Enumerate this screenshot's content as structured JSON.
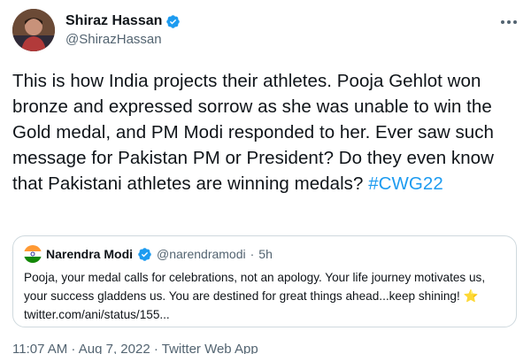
{
  "author": {
    "display_name": "Shiraz Hassan",
    "handle": "@ShirazHassan",
    "avatar_icon": "profile-photo",
    "verified": true
  },
  "tweet": {
    "text": "This is how India projects their athletes. Pooja Gehlot won bronze and expressed sorrow as she was unable to win the Gold medal, and PM Modi responded to her. Ever saw such message for Pakistan PM or President? Do they even know that Pakistani athletes are winning medals?",
    "hashtag": "#CWG22"
  },
  "quoted_tweet": {
    "display_name": "Narendra Modi",
    "handle": "@narendramodi",
    "separator": "·",
    "time": "5h",
    "text": "Pooja, your medal calls for celebrations, not an apology. Your life journey motivates us, your success gladdens us. You are destined for great things ahead...keep shining!",
    "emoji": "⭐",
    "link": "twitter.com/ani/status/155..."
  },
  "meta": {
    "footer": "11:07 AM · Aug 7, 2022 · Twitter Web App"
  },
  "colors": {
    "accent": "#1d9bf0",
    "text": "#0f1419",
    "secondary": "#536471",
    "border": "#cfd9de"
  }
}
